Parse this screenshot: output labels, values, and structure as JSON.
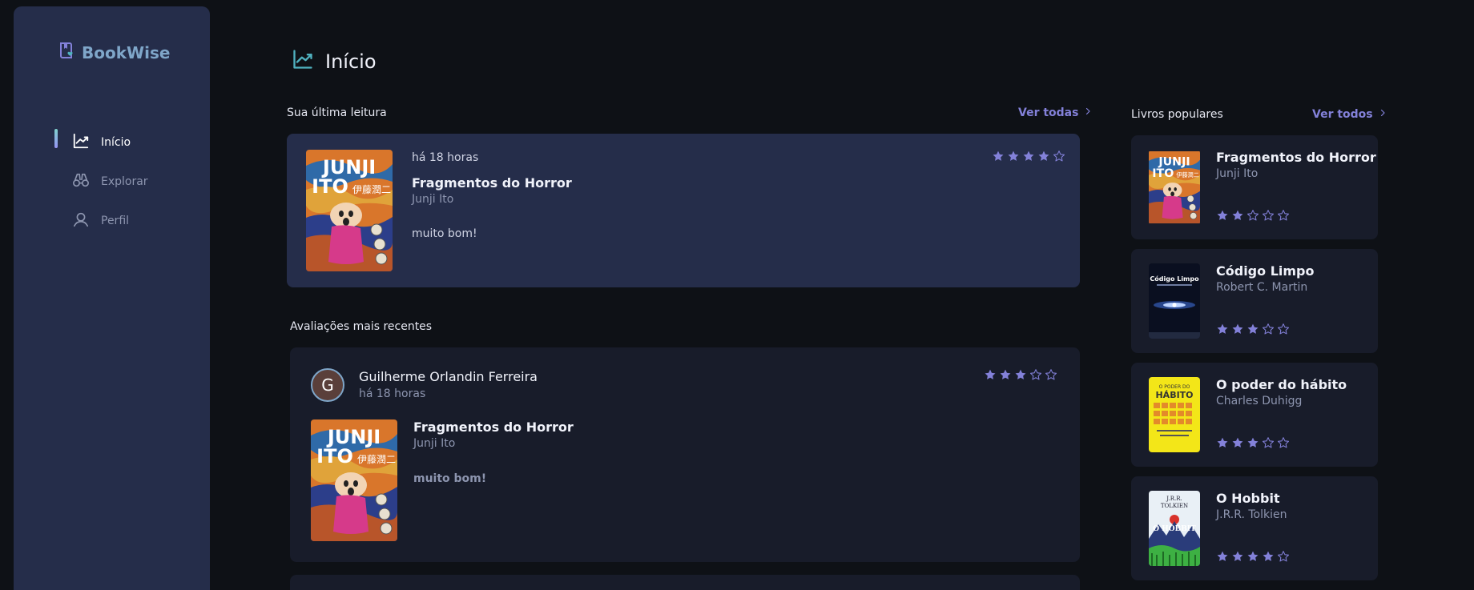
{
  "app": {
    "name": "BookWise"
  },
  "sidebar": {
    "items": [
      {
        "label": "Início",
        "icon": "chart-line-up-icon",
        "active": true
      },
      {
        "label": "Explorar",
        "icon": "binoculars-icon",
        "active": false
      },
      {
        "label": "Perfil",
        "icon": "user-icon",
        "active": false
      }
    ]
  },
  "page": {
    "title": "Início",
    "icon": "chart-line-up-icon"
  },
  "last_read": {
    "section_label": "Sua última leitura",
    "see_all": "Ver todas",
    "time": "há 18 horas",
    "book_title": "Fragmentos do Horror",
    "author": "Junji Ito",
    "comment": "muito bom!",
    "rating": 4
  },
  "recent_reviews": {
    "section_label": "Avaliações mais recentes",
    "items": [
      {
        "user_initial": "G",
        "user_name": "Guilherme Orlandin Ferreira",
        "time": "há 18 horas",
        "rating": 3,
        "book_title": "Fragmentos do Horror",
        "author": "Junji Ito",
        "comment": "muito bom!"
      }
    ]
  },
  "popular": {
    "section_label": "Livros populares",
    "see_all": "Ver todos",
    "books": [
      {
        "title": "Fragmentos do Horror",
        "author": "Junji Ito",
        "rating": 2
      },
      {
        "title": "Código Limpo",
        "author": "Robert C. Martin",
        "rating": 3
      },
      {
        "title": "O poder do hábito",
        "author": "Charles Duhigg",
        "rating": 3
      },
      {
        "title": "O Hobbit",
        "author": "J.R.R. Tolkien",
        "rating": 4
      }
    ]
  },
  "covers": {
    "junji_ito": {
      "line1": "JUNJI",
      "line2": "ITO",
      "kanji": "伊藤潤二"
    },
    "codigo_limpo": {
      "title": "Código Limpo"
    },
    "poder_habito": {
      "line1": "O PODER DO",
      "line2": "HÁBITO"
    },
    "hobbit": {
      "author": "J.R.R. TOLKIEN",
      "title": "O HOBBIT"
    }
  },
  "colors": {
    "background": "#0e1116",
    "sidebar": "#252d4a",
    "card": "#181c2a",
    "accent": "#8381d9",
    "star": "#8381d9",
    "text_muted": "#8d95af"
  }
}
